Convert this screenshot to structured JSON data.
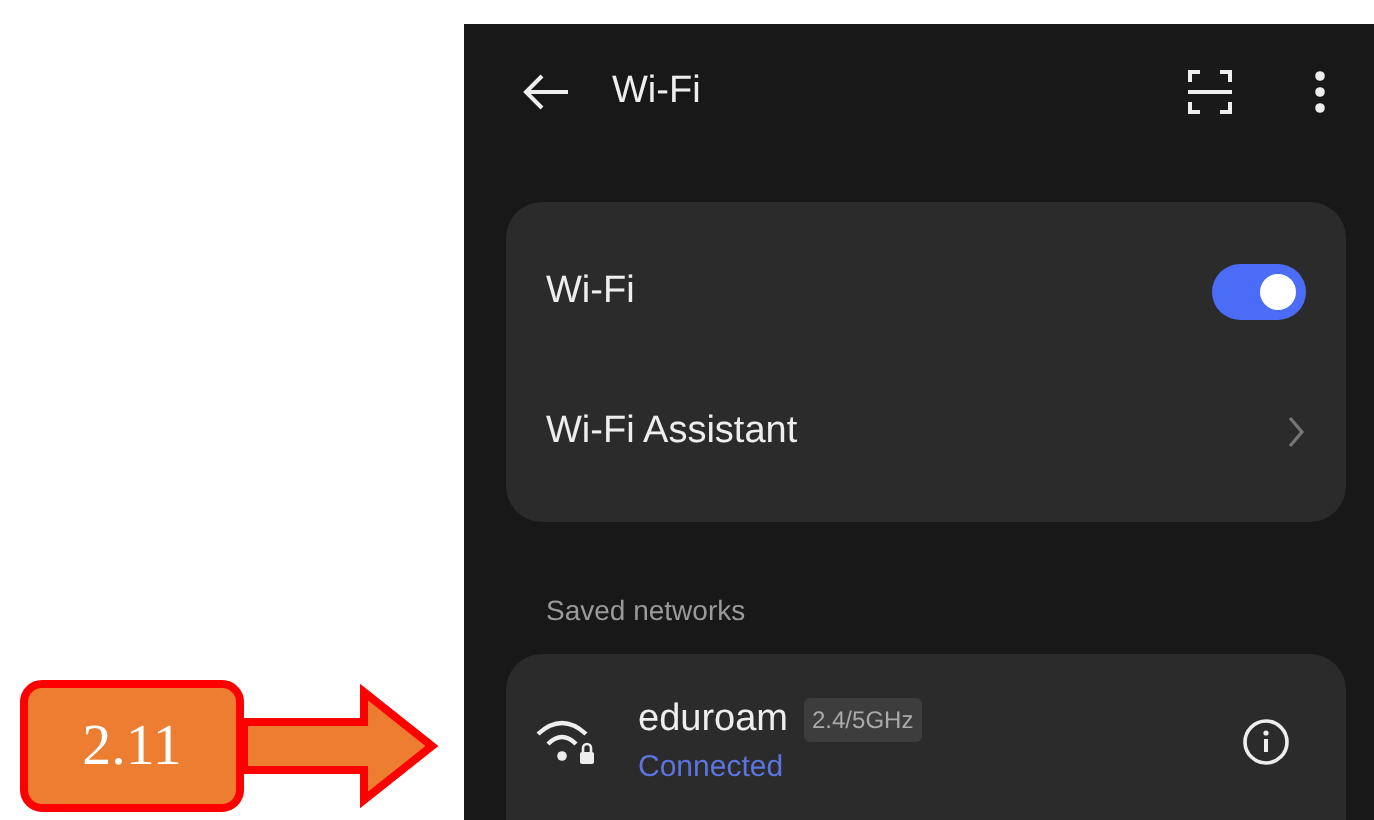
{
  "annotation": {
    "label": "2.11"
  },
  "header": {
    "title": "Wi-Fi"
  },
  "settings": [
    {
      "kind": "toggle",
      "label": "Wi-Fi",
      "on": true
    },
    {
      "kind": "link",
      "label": "Wi-Fi Assistant"
    }
  ],
  "saved_networks": {
    "heading": "Saved networks",
    "networks": [
      {
        "name": "eduroam",
        "band": "2.4/5GHz",
        "status": "Connected",
        "locked": true
      }
    ]
  }
}
